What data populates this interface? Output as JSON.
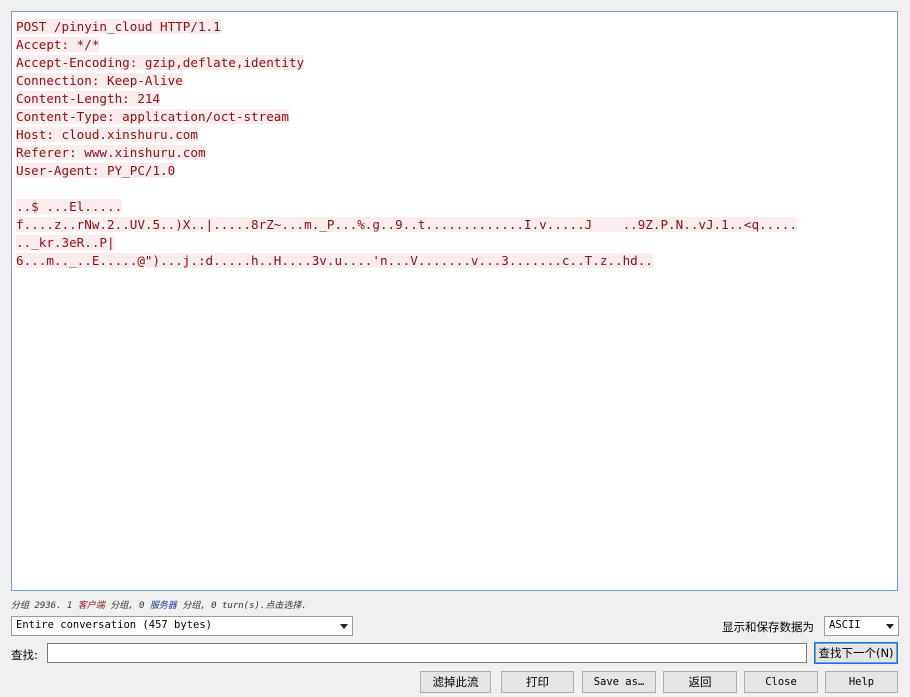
{
  "stream": {
    "lines": [
      "POST /pinyin_cloud HTTP/1.1",
      "Accept: */*",
      "Accept-Encoding: gzip,deflate,identity",
      "Connection: Keep-Alive",
      "Content-Length: 214",
      "Content-Type: application/oct-stream",
      "Host: cloud.xinshuru.com",
      "Referer: www.xinshuru.com",
      "User-Agent: PY_PC/1.0",
      "",
      "..$ ...El.....",
      "f....z..rNw.2..UV.5..)X..|.....8rZ~...m._P...%.g..9..t.............I.v.....J    ..9Z.P.N..vJ.1..<q.....",
      ".._kr.3eR..P|",
      "6...m.._..E.....@\")...j.:d.....h..H....3v.u....'n...V.......v...3.......c..T.z..hd.."
    ]
  },
  "status": {
    "prefix": "分组 2936. 1 ",
    "client": "客户端",
    "mid": " 分组, 0 ",
    "server": "服务器",
    "suffix": " 分组, 0 turn(s).点击选择."
  },
  "conversation_select": {
    "value": "Entire conversation (457 bytes)"
  },
  "show_as": {
    "label": "显示和保存数据为",
    "value": "ASCII"
  },
  "find": {
    "label": "查找:",
    "value": "",
    "next_label": "查找下一个(N)"
  },
  "buttons": {
    "filter_out": "滤掉此流",
    "print": "打印",
    "save_as": "Save as…",
    "back": "返回",
    "close": "Close",
    "help": "Help"
  },
  "colors": {
    "client_text": "#8b0e10",
    "client_bg": "#fbeded",
    "server_text": "#1a2f9b"
  }
}
